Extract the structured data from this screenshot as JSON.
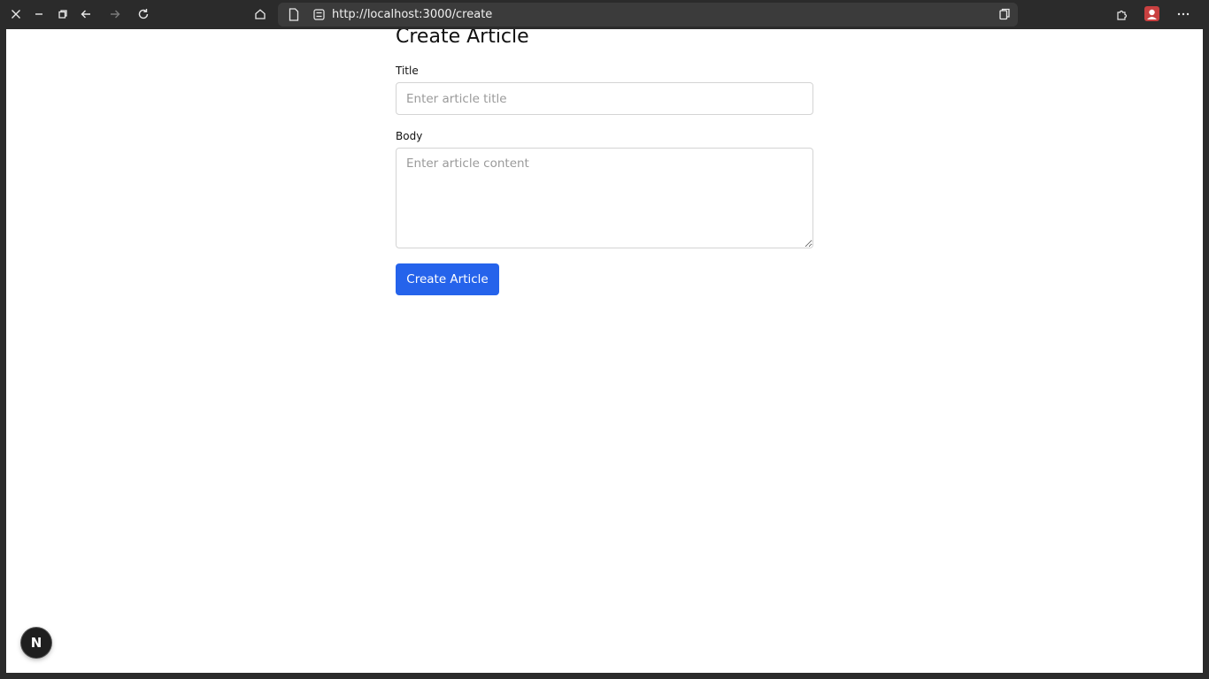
{
  "browser": {
    "url": "http://localhost:3000/create"
  },
  "page": {
    "title": "Create Article",
    "title_field": {
      "label": "Title",
      "value": "",
      "placeholder": "Enter article title"
    },
    "body_field": {
      "label": "Body",
      "value": "",
      "placeholder": "Enter article content"
    },
    "submit_label": "Create Article"
  },
  "dev_badge": {
    "letter": "N"
  },
  "colors": {
    "primary": "#2563eb",
    "chrome_bg": "#2b2b2b",
    "page_bg": "#ffffff"
  }
}
